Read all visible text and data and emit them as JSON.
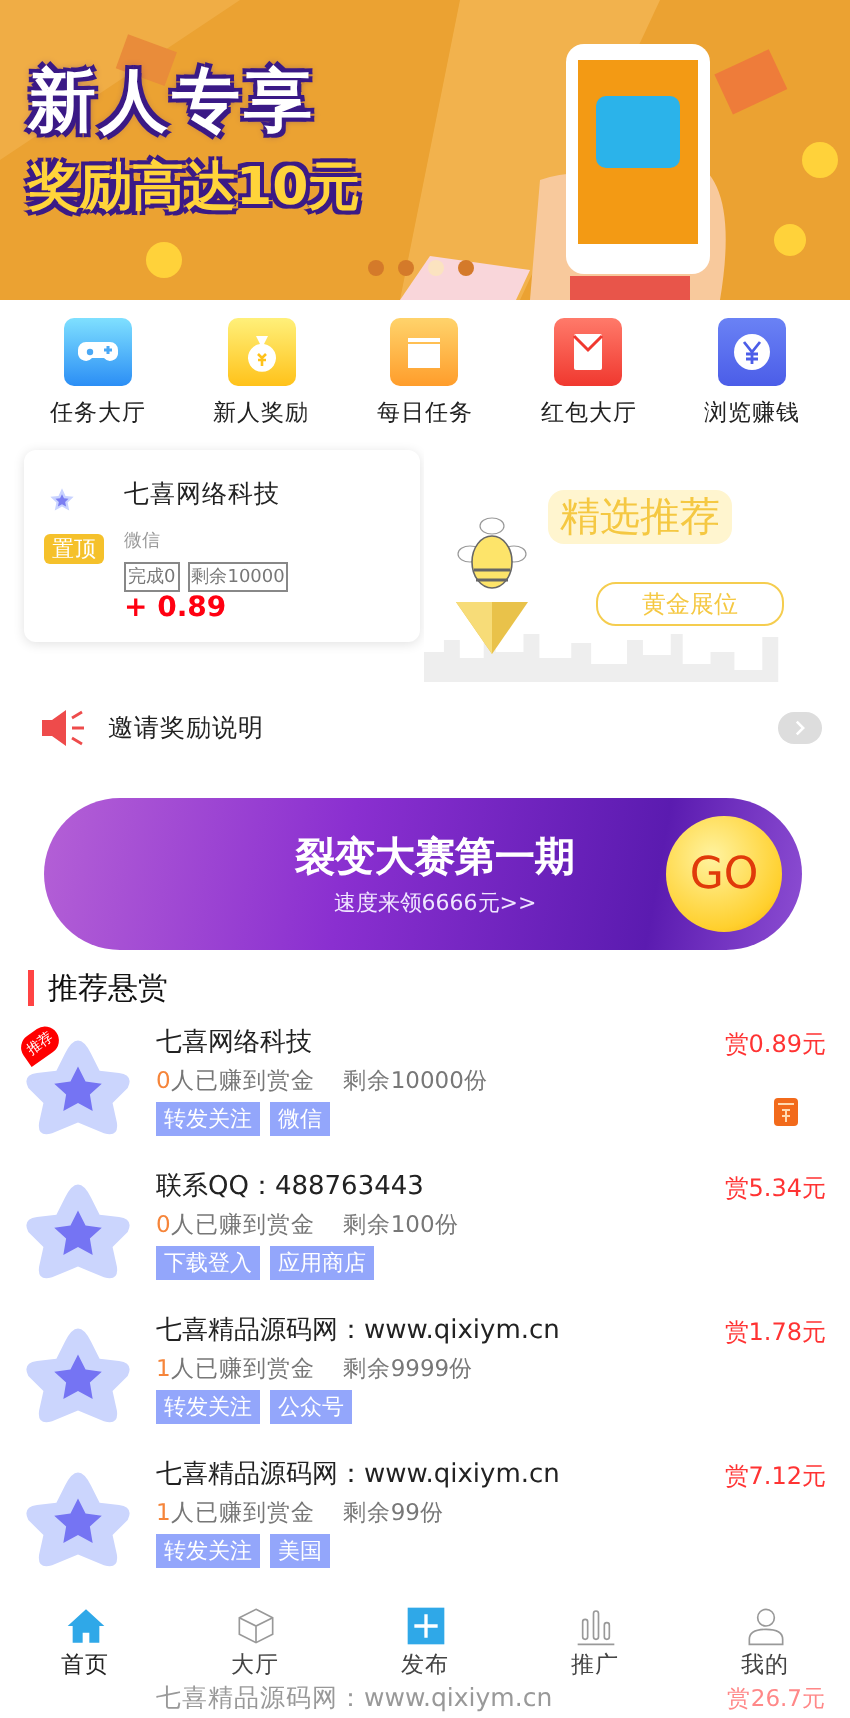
{
  "banner": {
    "headline": "新人专享",
    "subline": "奖励高达10元",
    "dots": [
      {
        "selected": false
      },
      {
        "selected": false
      },
      {
        "selected": true
      },
      {
        "selected": false
      }
    ]
  },
  "shortcuts": [
    {
      "label": "任务大厅",
      "kind": "game"
    },
    {
      "label": "新人奖励",
      "kind": "bag"
    },
    {
      "label": "每日任务",
      "kind": "box"
    },
    {
      "label": "红包大厅",
      "kind": "envelope"
    },
    {
      "label": "浏览赚钱",
      "kind": "yuan"
    }
  ],
  "top_task": {
    "badge": "置顶",
    "title": "七喜网络科技",
    "platform": "微信",
    "done": "完成0",
    "remaining": "剩余10000",
    "reward": "+ 0.89"
  },
  "promo": {
    "title": "精选推荐",
    "button": "黄金展位"
  },
  "notice": {
    "text": "邀请奖励说明"
  },
  "contest": {
    "title": "裂变大赛第一期",
    "subtitle": "速度来领6666元>>",
    "button": "GO"
  },
  "section_title": "推荐悬赏",
  "tasks": [
    {
      "title": "七喜网络科技",
      "earned": "0",
      "earned_label": "人已赚到赏金",
      "remaining": "剩余10000份",
      "tags": [
        "转发关注",
        "微信"
      ],
      "reward": "赏0.89元",
      "recommended": true,
      "ribbon": "推荐",
      "envelope": true
    },
    {
      "title": "联系QQ：488763443",
      "earned": "0",
      "earned_label": "人已赚到赏金",
      "remaining": "剩余100份",
      "tags": [
        "下载登入",
        "应用商店"
      ],
      "reward": "赏5.34元",
      "recommended": false,
      "envelope": false
    },
    {
      "title": "七喜精品源码网：www.qixiym.cn",
      "earned": "1",
      "earned_label": "人已赚到赏金",
      "remaining": "剩余9999份",
      "tags": [
        "转发关注",
        "公众号"
      ],
      "reward": "赏1.78元",
      "recommended": false,
      "envelope": false
    },
    {
      "title": "七喜精品源码网：www.qixiym.cn",
      "earned": "1",
      "earned_label": "人已赚到赏金",
      "remaining": "剩余99份",
      "tags": [
        "转发关注",
        "美国"
      ],
      "reward": "赏7.12元",
      "recommended": false,
      "envelope": false
    },
    {
      "title": "七喜精品源码网：www.qixiym.cn",
      "reward": "赏26.7元",
      "recommended": false,
      "envelope": false
    }
  ],
  "tab_bar": [
    {
      "label": "首页",
      "kind": "home",
      "selected": true
    },
    {
      "label": "大厅",
      "kind": "cube",
      "selected": false
    },
    {
      "label": "发布",
      "kind": "plus",
      "selected": false
    },
    {
      "label": "推广",
      "kind": "chart",
      "selected": false
    },
    {
      "label": "我的",
      "kind": "user",
      "selected": false
    }
  ]
}
